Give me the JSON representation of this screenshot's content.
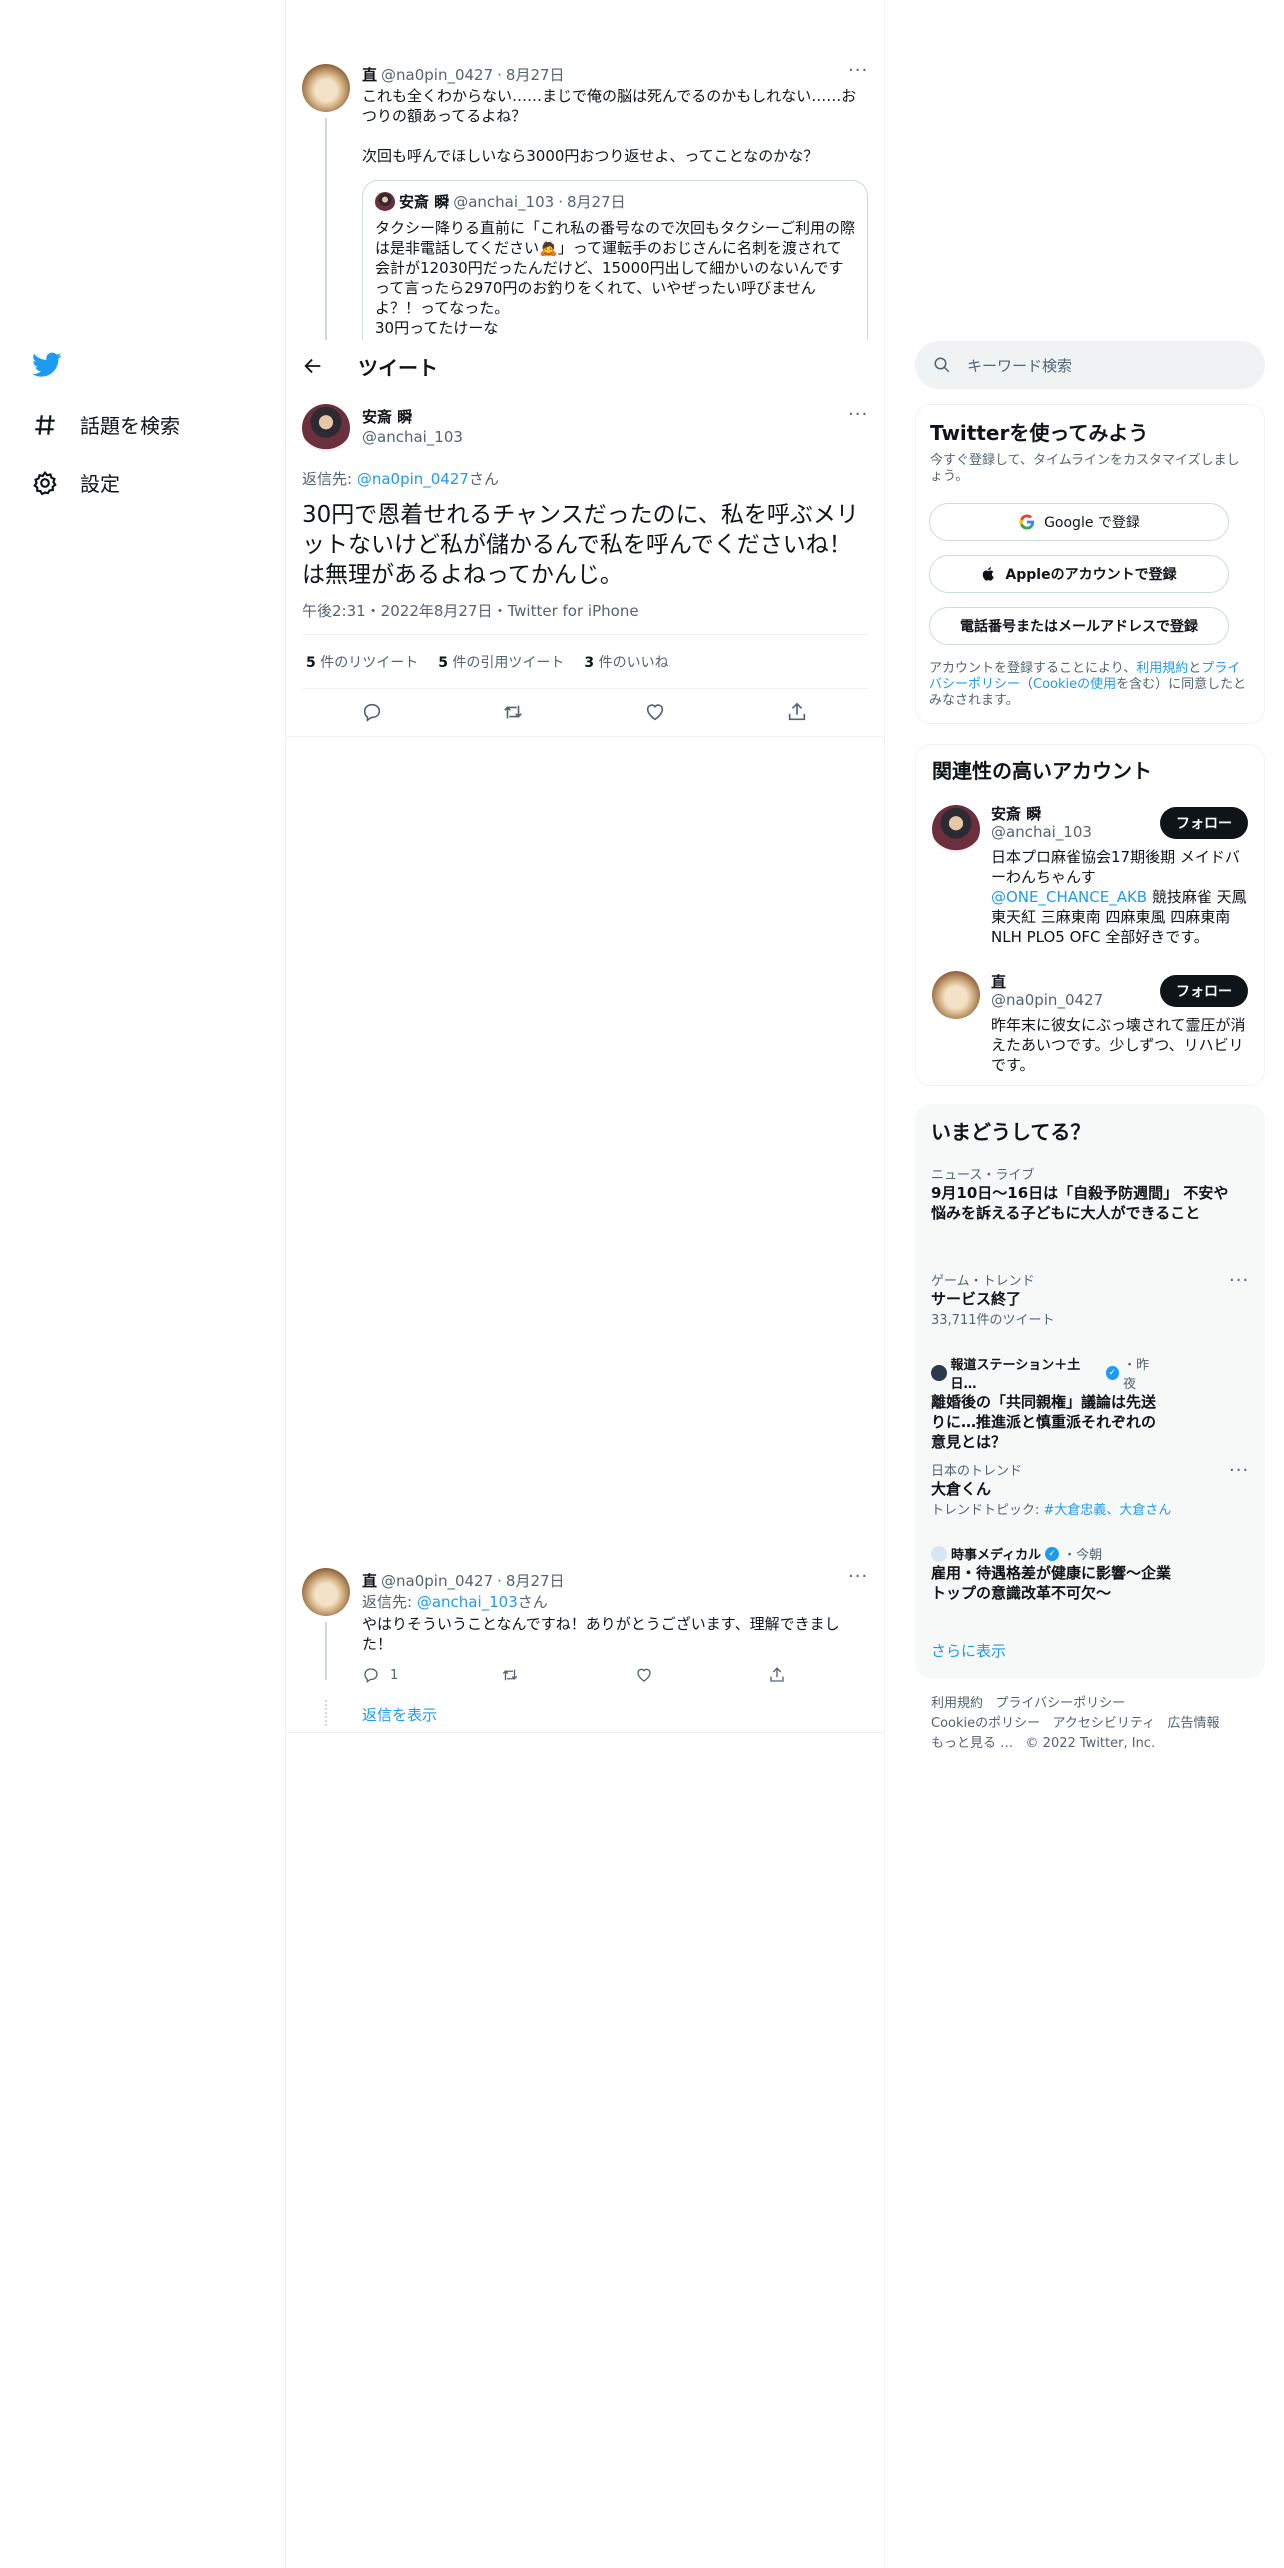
{
  "nav": {
    "logo": "twitter-bird-icon",
    "items": [
      {
        "icon": "hashtag-icon",
        "label": "話題を検索"
      },
      {
        "icon": "gear-icon",
        "label": "設定"
      }
    ]
  },
  "header": {
    "back_icon": "arrow-left-icon",
    "title": "ツイート"
  },
  "parent_tweet": {
    "name": "直",
    "handle": "@na0pin_0427",
    "date": "8月27日",
    "line1": "これも全くわからない……まじで俺の脳は死んでるのかもしれない……おつりの額あってるよね？",
    "line2": "次回も呼んでほしいなら3000円おつり返せよ、ってことなのかな？",
    "quote": {
      "name": "安斎 瞬",
      "handle": "@anchai_103",
      "date": "8月27日",
      "text": "タクシー降りる直前に「これ私の番号なので次回もタクシーご利用の際は是非電話してください🙇」って運転手のおじさんに名刺を渡されて会計が12030円だったんだけど、15000円出して細かいのないんですって言ったら2970円のお釣りをくれて、いやぜったい呼びませんよ？！ってなった。",
      "text2": "30円ってたけーな"
    }
  },
  "main_tweet": {
    "name": "安斎 瞬",
    "handle": "@anchai_103",
    "reply_prefix": "返信先: ",
    "reply_to": "@na0pin_0427",
    "reply_suffix": "さん",
    "text": "30円で恩着せれるチャンスだったのに、私を呼ぶメリットないけど私が儲かるんで私を呼んでくださいね！は無理があるよねってかんじ。",
    "meta": "午後2:31・2022年8月27日・Twitter for iPhone",
    "stats": [
      {
        "count": "5",
        "label": "件のリツイート"
      },
      {
        "count": "5",
        "label": "件の引用ツイート"
      },
      {
        "count": "3",
        "label": "件のいいね"
      }
    ]
  },
  "reply_tweet": {
    "name": "直",
    "handle": "@na0pin_0427",
    "date": "8月27日",
    "reply_prefix": "返信先: ",
    "reply_to": "@anchai_103",
    "reply_suffix": "さん",
    "text": "やはりそういうことなんですね！ありがとうございます、理解できました！",
    "reply_count": "1",
    "show_replies": "返信を表示"
  },
  "search": {
    "placeholder": "キーワード検索"
  },
  "signup": {
    "title": "Twitterを使ってみよう",
    "subtitle": "今すぐ登録して、タイムラインをカスタマイズしましょう。",
    "google": "Google で登録",
    "apple": "Appleのアカウントで登録",
    "phone": "電話番号またはメールアドレスで登録",
    "legal_1": "アカウントを登録することにより、",
    "legal_terms": "利用規約",
    "legal_2": "と",
    "legal_privacy": "プライバシーポリシー",
    "legal_3": "（",
    "legal_cookie": "Cookieの使用",
    "legal_4": "を含む）に同意したとみなされます。"
  },
  "related": {
    "title": "関連性の高いアカウント",
    "follow": "フォロー",
    "accounts": [
      {
        "name": "安斎 瞬",
        "handle": "@anchai_103",
        "bio_1": "日本プロ麻雀協会17期後期 メイドバーわんちゃんす",
        "bio_link": "@ONE_CHANCE_AKB",
        "bio_2": " 競技麻雀 天鳳 東天紅 三麻東南 四麻東風 四麻東南 NLH PLO5 OFC 全部好きです。"
      },
      {
        "name": "直",
        "handle": "@na0pin_0427",
        "bio_1": "昨年末に彼女にぶっ壊されて霊圧が消えたあいつです。少しずつ、リハビリです。"
      }
    ]
  },
  "trends": {
    "title": "いまどうしてる？",
    "items": [
      {
        "category": "ニュース・ライブ",
        "title": "9月10日〜16日は「自殺予防週間」 不安や悩みを訴える子どもに大人ができること"
      },
      {
        "category": "ゲーム・トレンド",
        "title": "サービス終了",
        "sub": "33,711件のツイート"
      },
      {
        "source": "報道ステーション＋土日…",
        "time": "・昨夜",
        "title": "離婚後の「共同親権」議論は先送りに…推進派と慎重派それぞれの意見とは？"
      },
      {
        "category": "日本のトレンド",
        "title": "大倉くん",
        "sub_prefix": "トレンドトピック: ",
        "sub_links": "#大倉忠義、大倉さん"
      },
      {
        "source": "時事メディカル",
        "time": "・今朝",
        "title": "雇用・待遇格差が健康に影響～企業トップの意識改革不可欠～"
      }
    ],
    "more": "さらに表示"
  },
  "footer": {
    "terms": "利用規約",
    "privacy": "プライバシーポリシー",
    "cookie": "Cookieのポリシー",
    "accessibility": "アクセシビリティ",
    "ads": "広告情報",
    "more": "もっと見る …",
    "copyright": "© 2022 Twitter, Inc."
  },
  "colors": {
    "accent": "#1d9bf0",
    "text": "#0f1419",
    "muted": "#536471",
    "border": "#eff3f4"
  }
}
